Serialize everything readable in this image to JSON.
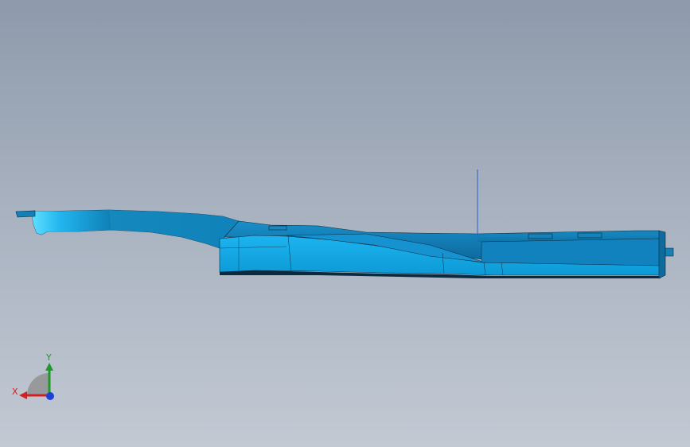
{
  "viewport": {
    "background_top": "#8e9aab",
    "background_bottom": "#c2c9d3",
    "model_color": "#16a8e6",
    "model_shadow_color": "#0d6d9c",
    "model_highlight_color": "#39c6ff",
    "edge_color": "#0a2a40"
  },
  "triad": {
    "x_label": "X",
    "y_label": "Y",
    "x_color": "#d42020",
    "y_color": "#1d9a2a",
    "z_color": "#1f3fd6"
  }
}
